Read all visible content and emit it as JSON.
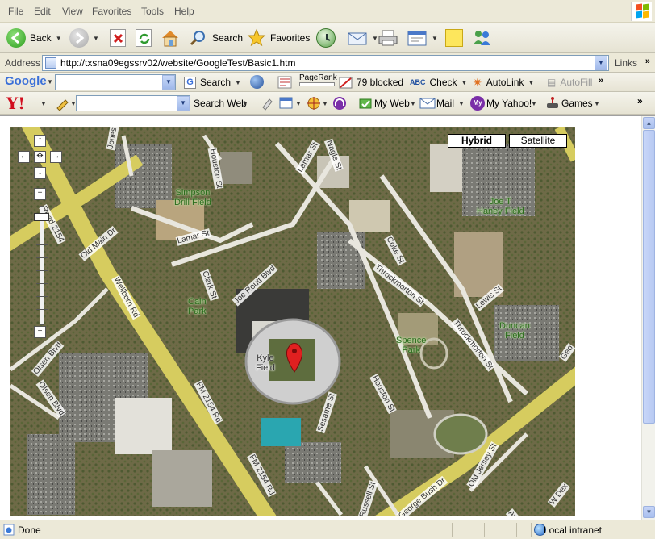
{
  "menubar": {
    "items": [
      "File",
      "Edit",
      "View",
      "Favorites",
      "Tools",
      "Help"
    ]
  },
  "toolbar": {
    "back": "Back",
    "search": "Search",
    "favorites": "Favorites"
  },
  "address": {
    "label": "Address",
    "url": "http://txsna09egssrv02/website/GoogleTest/Basic1.htm",
    "links": "Links"
  },
  "google_bar": {
    "logo": "Google",
    "search": "Search",
    "pagerank": "PageRank",
    "blocked": "79 blocked",
    "check": "Check",
    "autolink": "AutoLink",
    "autofill": "AutoFill"
  },
  "yahoo_bar": {
    "logo": "Y!",
    "search_web": "Search Web",
    "my_web": "My Web",
    "mail": "Mail",
    "my_yahoo": "My Yahoo!",
    "games": "Games"
  },
  "map": {
    "hybrid": "Hybrid",
    "satellite": "Satellite",
    "labels": {
      "simpson": [
        "Simpson",
        "Drill Field"
      ],
      "joe": [
        "Joe T",
        "Haney Field"
      ],
      "cain": [
        "Cain",
        "Park"
      ],
      "spence": [
        "Spence",
        "Park"
      ],
      "duncan": [
        "Duncan",
        "Field"
      ],
      "kyle": [
        "Kyle",
        "Field"
      ]
    },
    "streets": {
      "jones": "Jones St",
      "houston_top": "Houston St",
      "nagle": "Nagle St",
      "lamar_top": "Lamar St",
      "lamar": "Lamar St",
      "old_main": "Old Main Dr",
      "road2154": "Road 2154",
      "wellborn": "Wellborn Rd",
      "clark": "Clark St",
      "joe_routt": "Joe Routt Blvd",
      "coke": "Coke St",
      "throck_1": "Throckmorton St",
      "throck_2": "Throckmorton St",
      "lewis": "Lewis St",
      "olsen_1": "Olsen Blvd",
      "olsen_2": "Olsen Blvd",
      "fm_1": "FM 2154 Rd",
      "fm_2": "FM 2154 Rd",
      "houston": "Houston St",
      "sesame": "Sesame St",
      "russell": "Russell St",
      "george_bush": "George Bush Dr",
      "old_jersey": "Old Jersey St",
      "w_dex": "W Dex",
      "ayrsh": "Ayrsh",
      "geo": "Geo"
    }
  },
  "status": {
    "text": "Done",
    "zone": "Local intranet"
  }
}
